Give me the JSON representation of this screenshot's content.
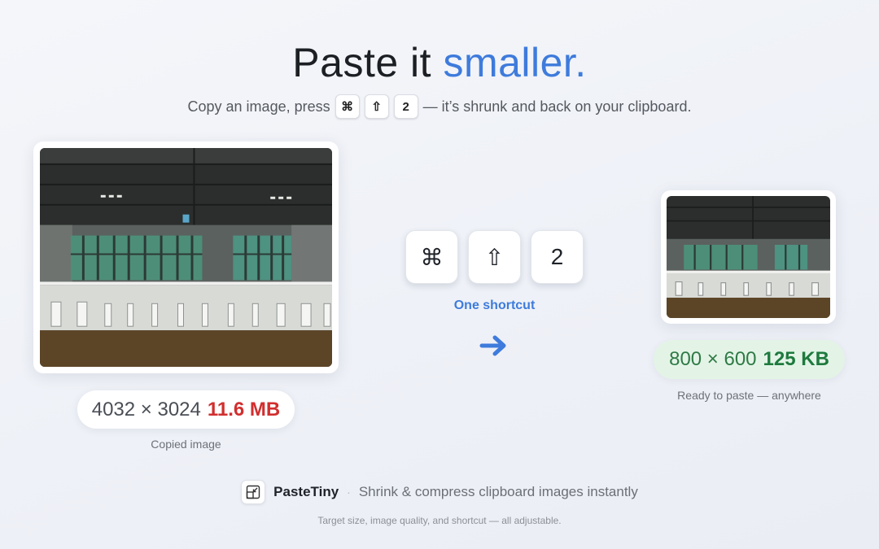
{
  "headline": {
    "prefix": "Paste it",
    "accent": "smaller."
  },
  "subline": {
    "prefix": "Copy an image, press",
    "keys": [
      "⌘",
      "⇧",
      "2"
    ],
    "suffix": "— it’s shrunk and back on your clipboard."
  },
  "original": {
    "dimensions": "4032 × 3024",
    "size": "11.6 MB",
    "caption": "Copied image"
  },
  "shortcut": {
    "keys": [
      "⌘",
      "⇧",
      "2"
    ],
    "label": "One shortcut",
    "arrow_icon": "arrow-right-icon"
  },
  "result": {
    "dimensions": "800 × 600",
    "size": "125 KB",
    "caption": "Ready to paste — anywhere"
  },
  "footer": {
    "icon": "resize-icon",
    "brand": "PasteTiny",
    "separator": "·",
    "tagline": "Shrink & compress clipboard images instantly",
    "fine_print": "Target size, image quality, and shortcut — all adjustable."
  },
  "colors": {
    "accent": "#3e7bdc",
    "bad": "#d12f2f",
    "good": "#1e7a3d",
    "good_bg": "#e3f4e7"
  }
}
